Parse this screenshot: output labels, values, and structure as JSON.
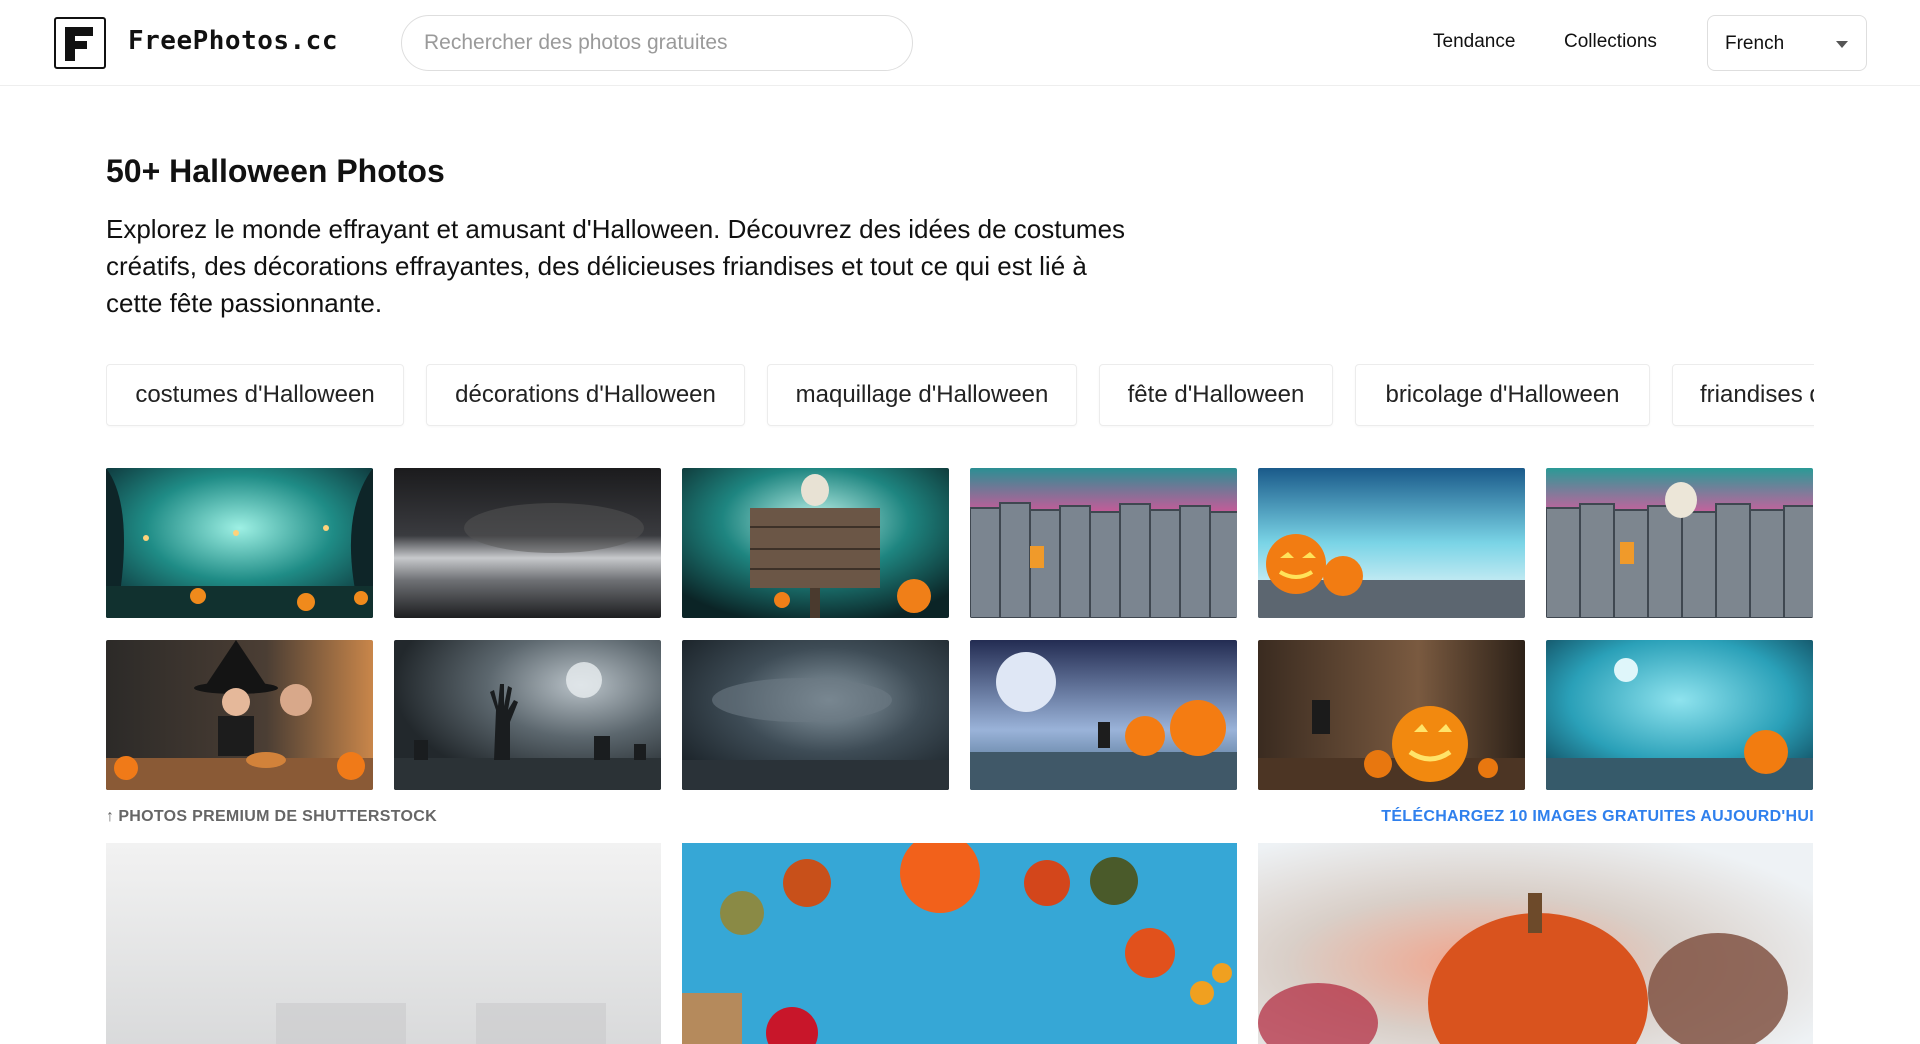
{
  "header": {
    "brand": "FreePhotos.cc",
    "search_placeholder": "Rechercher des photos gratuites",
    "nav": {
      "trending": "Tendance",
      "collections": "Collections"
    },
    "language": "French"
  },
  "intro": {
    "title": "50+ Halloween Photos",
    "description": "Explorez le monde effrayant et amusant d'Halloween. Découvrez des idées de costumes créatifs, des décorations effrayantes, des délicieuses friandises et tout ce qui est lié à cette fête passionnante."
  },
  "chips": [
    "costumes d'Halloween",
    "décorations d'Halloween",
    "maquillage d'Halloween",
    "fête d'Halloween",
    "bricolage d'Halloween",
    "friandises d'Halloween"
  ],
  "premium": {
    "note": "PHOTOS PREMIUM DE SHUTTERSTOCK",
    "cta": "TÉLÉCHARGEZ 10 IMAGES GRATUITES AUJOURD'HUI"
  },
  "colors": {
    "accent_link": "#2f80ed",
    "text": "#111111",
    "muted": "#666666"
  },
  "icons": {
    "logo": "freephotos-logo-icon",
    "language_caret": "chevron-down-icon",
    "premium_arrow": "arrow-up-icon"
  }
}
